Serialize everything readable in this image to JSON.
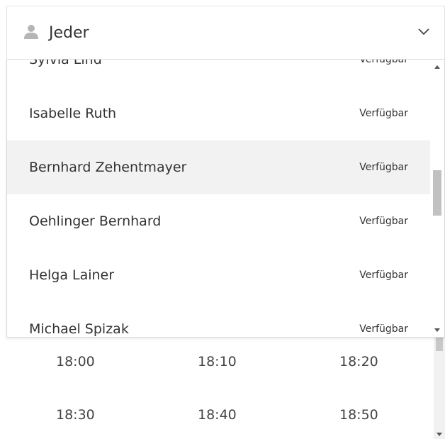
{
  "selector": {
    "label": "Jeder",
    "icon": "person-icon",
    "expand_icon": "chevron-down-icon"
  },
  "dropdown": {
    "items": [
      {
        "name": "Sylvia Lind",
        "status": "Verfügbar"
      },
      {
        "name": "Isabelle Ruth",
        "status": "Verfügbar"
      },
      {
        "name": "Bernhard Zehentmayer",
        "status": "Verfügbar"
      },
      {
        "name": "Oehlinger Bernhard",
        "status": "Verfügbar"
      },
      {
        "name": "Helga Lainer",
        "status": "Verfügbar"
      },
      {
        "name": "Michael Spizak",
        "status": "Verfügbar"
      }
    ],
    "highlighted_item": "Bernhard Zehentmayer"
  },
  "time_slots": {
    "rows": [
      [
        "18:00",
        "18:10",
        "18:20"
      ],
      [
        "18:30",
        "18:40",
        "18:50"
      ]
    ]
  },
  "colors": {
    "highlight_bg": "#f2f2f2",
    "icon_gray": "#b5b5b5",
    "text": "#333333"
  }
}
